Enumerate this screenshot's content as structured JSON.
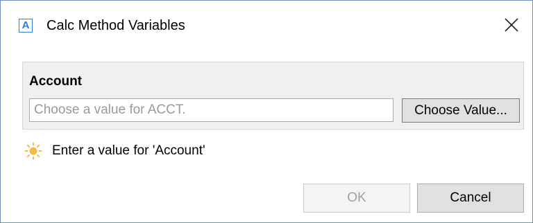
{
  "window": {
    "title": "Calc Method Variables",
    "app_icon_letter": "A",
    "app_icon": "app-logo-icon",
    "close_icon": "close-icon",
    "accent_color": "#2f7ed8"
  },
  "variable_group": {
    "label": "Account",
    "input_value": "",
    "input_placeholder": "Choose a value for ACCT.",
    "choose_button_label": "Choose Value..."
  },
  "validation": {
    "icon": "sun-icon",
    "icon_color": "#f5a623",
    "message": "Enter a value for 'Account'"
  },
  "buttons": {
    "ok_label": "OK",
    "ok_enabled": false,
    "cancel_label": "Cancel"
  }
}
